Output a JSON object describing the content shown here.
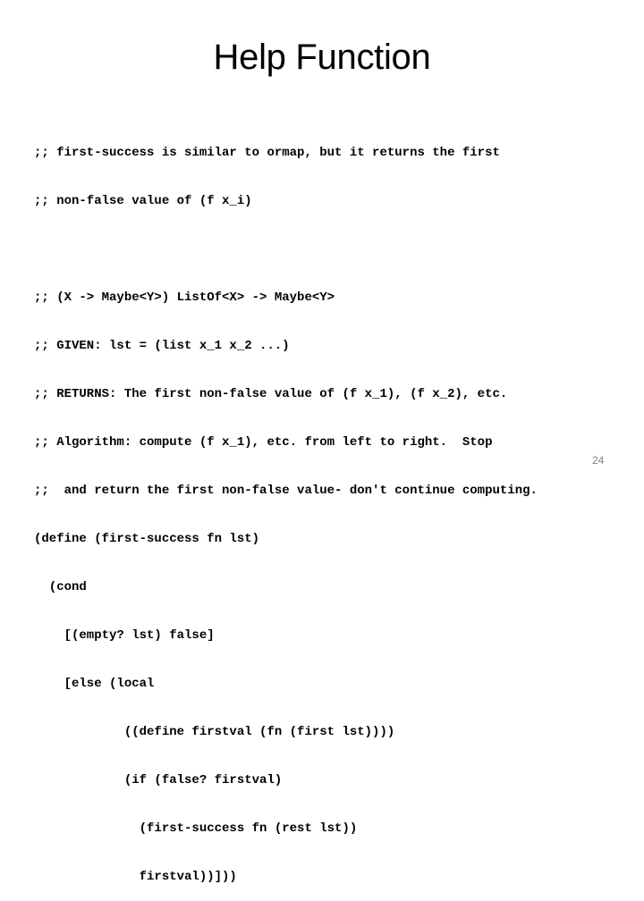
{
  "slide": {
    "title": "Help Function",
    "page_number": "24"
  },
  "code": {
    "lines": [
      ";; first-success is similar to ormap, but it returns the first",
      ";; non-false value of (f x_i)",
      "",
      ";; (X -> Maybe<Y>) ListOf<X> -> Maybe<Y>",
      ";; GIVEN: lst = (list x_1 x_2 ...)",
      ";; RETURNS: The first non-false value of (f x_1), (f x_2), etc.",
      ";; Algorithm: compute (f x_1), etc. from left to right.  Stop",
      ";;  and return the first non-false value- don't continue computing.",
      "(define (first-success fn lst)",
      "  (cond",
      "    [(empty? lst) false]",
      "    [else (local",
      "            ((define firstval (fn (first lst))))",
      "            (if (false? firstval)",
      "              (first-success fn (rest lst))",
      "              firstval))]))"
    ]
  }
}
